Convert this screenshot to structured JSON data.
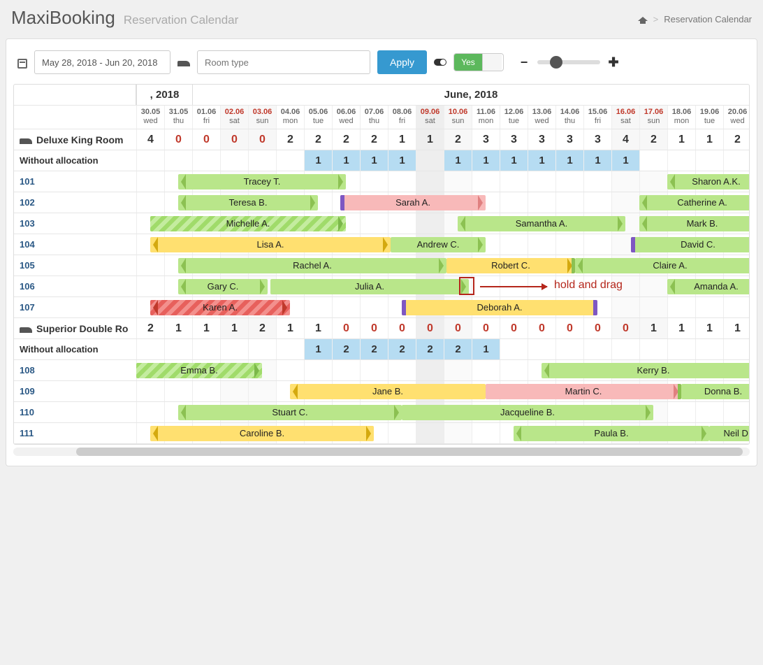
{
  "app": {
    "title": "MaxiBooking",
    "subtitle": "Reservation Calendar"
  },
  "breadcrumb": {
    "current": "Reservation Calendar"
  },
  "toolbar": {
    "date_range": "May 28, 2018 - Jun 20, 2018",
    "room_type_placeholder": "Room type",
    "apply_label": "Apply",
    "toggle_yes": "Yes"
  },
  "months": {
    "may_label": ", 2018",
    "june_label": "June, 2018"
  },
  "dates": [
    {
      "d": "30.05",
      "w": "wed",
      "weekend": false,
      "today": false
    },
    {
      "d": "31.05",
      "w": "thu",
      "weekend": false,
      "today": false
    },
    {
      "d": "01.06",
      "w": "fri",
      "weekend": false,
      "today": false
    },
    {
      "d": "02.06",
      "w": "sat",
      "weekend": true,
      "today": false
    },
    {
      "d": "03.06",
      "w": "sun",
      "weekend": true,
      "today": false
    },
    {
      "d": "04.06",
      "w": "mon",
      "weekend": false,
      "today": false
    },
    {
      "d": "05.06",
      "w": "tue",
      "weekend": false,
      "today": false
    },
    {
      "d": "06.06",
      "w": "wed",
      "weekend": false,
      "today": false
    },
    {
      "d": "07.06",
      "w": "thu",
      "weekend": false,
      "today": false
    },
    {
      "d": "08.06",
      "w": "fri",
      "weekend": false,
      "today": false
    },
    {
      "d": "09.06",
      "w": "sat",
      "weekend": true,
      "today": true
    },
    {
      "d": "10.06",
      "w": "sun",
      "weekend": true,
      "today": false
    },
    {
      "d": "11.06",
      "w": "mon",
      "weekend": false,
      "today": false
    },
    {
      "d": "12.06",
      "w": "tue",
      "weekend": false,
      "today": false
    },
    {
      "d": "13.06",
      "w": "wed",
      "weekend": false,
      "today": false
    },
    {
      "d": "14.06",
      "w": "thu",
      "weekend": false,
      "today": false
    },
    {
      "d": "15.06",
      "w": "fri",
      "weekend": false,
      "today": false
    },
    {
      "d": "16.06",
      "w": "sat",
      "weekend": true,
      "today": false
    },
    {
      "d": "17.06",
      "w": "sun",
      "weekend": true,
      "today": false
    },
    {
      "d": "18.06",
      "w": "mon",
      "weekend": false,
      "today": false
    },
    {
      "d": "19.06",
      "w": "tue",
      "weekend": false,
      "today": false
    },
    {
      "d": "20.06",
      "w": "wed",
      "weekend": false,
      "today": false
    }
  ],
  "room_types": [
    {
      "name": "Deluxe King Room",
      "counts": [
        "4",
        "0",
        "0",
        "0",
        "0",
        "2",
        "2",
        "2",
        "2",
        "1",
        "1",
        "2",
        "3",
        "3",
        "3",
        "3",
        "3",
        "4",
        "2",
        "1",
        "1",
        "2"
      ],
      "red_idx": [
        1,
        2,
        3,
        4
      ],
      "without_alloc_label": "Without allocation",
      "without_alloc": [
        "",
        "",
        "",
        "",
        "",
        "",
        "1",
        "1",
        "1",
        "1",
        "",
        "1",
        "1",
        "1",
        "1",
        "1",
        "1",
        "1",
        "",
        "",
        "",
        ""
      ],
      "rooms": [
        {
          "num": "101",
          "bars": [
            {
              "label": "Tracey T.",
              "color": "green",
              "start": 1,
              "end": 7,
              "al": true,
              "ar": true
            },
            {
              "label": "Sharon A.K.",
              "color": "green",
              "start": 18.5,
              "end": 22,
              "al": true
            }
          ]
        },
        {
          "num": "102",
          "bars": [
            {
              "label": "Teresa B.",
              "color": "green",
              "start": 1,
              "end": 6,
              "al": true,
              "ar": true
            },
            {
              "label": "Sarah A.",
              "color": "pink",
              "start": 6.8,
              "end": 12,
              "cls": "cap-left-purple",
              "ar": true
            },
            {
              "label": "Catherine A.",
              "color": "green",
              "start": 17.5,
              "end": 22,
              "al": true
            }
          ]
        },
        {
          "num": "103",
          "bars": [
            {
              "label": "Michelle A.",
              "color": "hatched-green",
              "start": 0,
              "end": 7,
              "ar": true
            },
            {
              "label": "Samantha A.",
              "color": "green",
              "start": 11,
              "end": 17,
              "al": true,
              "ar": true
            },
            {
              "label": "Mark B.",
              "color": "green",
              "start": 17.5,
              "end": 22,
              "al": true,
              "cls": "cap-right-orange"
            }
          ]
        },
        {
          "num": "104",
          "bars": [
            {
              "label": "Lisa A.",
              "color": "yellow",
              "start": 0,
              "end": 8.6,
              "al": true,
              "ar": true
            },
            {
              "label": "Andrew C.",
              "color": "green",
              "start": 8.6,
              "end": 12,
              "ar": true
            },
            {
              "label": "David C.",
              "color": "green",
              "start": 17.2,
              "end": 22,
              "cls": "cap-left-purple cap-right-purple"
            }
          ]
        },
        {
          "num": "105",
          "bars": [
            {
              "label": "Rachel A.",
              "color": "green",
              "start": 1,
              "end": 10.6,
              "al": true,
              "ar": true
            },
            {
              "label": "Robert C.",
              "color": "yellow",
              "start": 10.6,
              "end": 15.2,
              "ar": true,
              "cls": "cap-right-green"
            },
            {
              "label": "Claire A.",
              "color": "green",
              "start": 15.2,
              "end": 22,
              "al": true
            }
          ]
        },
        {
          "num": "106",
          "bars": [
            {
              "label": "Gary C.",
              "color": "green",
              "start": 1,
              "end": 4.2,
              "al": true,
              "ar": true
            },
            {
              "label": "Julia A.",
              "color": "green",
              "start": 4.3,
              "end": 11.4,
              "ar": true
            },
            {
              "label": "Amanda A.",
              "color": "green",
              "start": 18.5,
              "end": 22,
              "al": true
            }
          ]
        },
        {
          "num": "107",
          "bars": [
            {
              "label": "Karen A.",
              "color": "hatched-red",
              "start": 0,
              "end": 5,
              "al": true,
              "ar": true
            },
            {
              "label": "Deborah A.",
              "color": "yellow",
              "start": 9,
              "end": 16,
              "cls": "cap-left-purple cap-right-purple"
            }
          ]
        }
      ]
    },
    {
      "name": "Superior Double Ro",
      "counts": [
        "2",
        "1",
        "1",
        "1",
        "2",
        "1",
        "1",
        "0",
        "0",
        "0",
        "0",
        "0",
        "0",
        "0",
        "0",
        "0",
        "0",
        "0",
        "1",
        "1",
        "1",
        "1"
      ],
      "red_idx": [
        7,
        8,
        9,
        10,
        11,
        12,
        13,
        14,
        15,
        16,
        17
      ],
      "without_alloc_label": "Without allocation",
      "without_alloc": [
        "",
        "",
        "",
        "",
        "",
        "",
        "1",
        "2",
        "2",
        "2",
        "2",
        "2",
        "1",
        "",
        "",
        "",
        "",
        "",
        "",
        "",
        "",
        ""
      ],
      "rooms": [
        {
          "num": "108",
          "bars": [
            {
              "label": "Emma B.",
              "color": "hatched-green",
              "start": -1,
              "end": 4,
              "ar": true
            },
            {
              "label": "Kerry B.",
              "color": "green",
              "start": 14,
              "end": 22,
              "al": true,
              "cls": "cap-right-orange"
            }
          ]
        },
        {
          "num": "109",
          "bars": [
            {
              "label": "Jane B.",
              "color": "yellow",
              "start": 5,
              "end": 12,
              "al": true
            },
            {
              "label": "Martin C.",
              "color": "pink",
              "start": 12,
              "end": 19,
              "ar": true,
              "cls": "cap-right-green"
            },
            {
              "label": "Donna B.",
              "color": "green",
              "start": 19,
              "end": 22
            }
          ]
        },
        {
          "num": "110",
          "bars": [
            {
              "label": "Stuart C.",
              "color": "green",
              "start": 1,
              "end": 9,
              "al": true,
              "ar": true
            },
            {
              "label": "Jacqueline B.",
              "color": "green",
              "start": 9,
              "end": 18,
              "ar": true
            }
          ]
        },
        {
          "num": "111",
          "bars": [
            {
              "label": "Caroline B.",
              "color": "yellow",
              "start": 0,
              "end": 8,
              "al": true,
              "ar": true
            },
            {
              "label": "Paula B.",
              "color": "green",
              "start": 13,
              "end": 20,
              "al": true,
              "ar": true
            },
            {
              "label": "Neil D.",
              "color": "green",
              "start": 20,
              "end": 22
            }
          ]
        }
      ]
    }
  ],
  "annotation": {
    "text": "hold and drag"
  }
}
